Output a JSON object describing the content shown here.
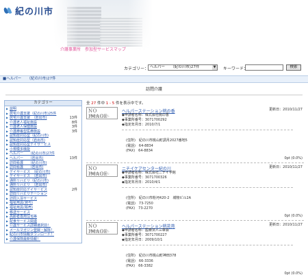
{
  "header": {
    "logo_text": "紀の川市",
    "subtitle": "介護事業所　参加型サービスマップ"
  },
  "search": {
    "category_label": "カテゴリー：",
    "category_value": "ヘルパー　　（紀の川市)27件",
    "keyword_label": "キーワード：",
    "keyword_value": "",
    "button_label": "検索"
  },
  "breadcrumb": "■ヘルパー　　（紀の川市)27件",
  "section_title": "訪問介護",
  "sidebar": {
    "title": "カテゴリー",
    "items": [
      {
        "label": "説明",
        "count": ""
      },
      {
        "label": "居宅介護支援（紀の川市)25件",
        "count": ""
      },
      {
        "label": "居宅介護支援　（岩出市)",
        "count": "13件"
      },
      {
        "label": "介護老人福祉施設",
        "count": "8件"
      },
      {
        "label": "介護老人保健施設",
        "count": "3件"
      },
      {
        "label": "介護療養型医療施設",
        "count": "3件"
      },
      {
        "label": "認知症対応型（紀の川市)",
        "count": ""
      },
      {
        "label": "認知症対応型（岩出市)",
        "count": ""
      },
      {
        "label": "認知症対応型デイサービス",
        "count": ""
      },
      {
        "label": "小規模多機能",
        "count": ""
      },
      {
        "label": "ヘルパー　　（紀の川市)27件",
        "count": ""
      },
      {
        "label": "ヘルパー　　（岩出市)",
        "count": "13件"
      },
      {
        "label": "訪問看護　　（紀の川市)",
        "count": ""
      },
      {
        "label": "訪問看護　　（岩出市)",
        "count": ""
      },
      {
        "label": "デイサービス　（紀の川市)",
        "count": ""
      },
      {
        "label": "デイサービス　（岩出市)",
        "count": ""
      },
      {
        "label": "通所リハビリ（紀の川市)",
        "count": ""
      },
      {
        "label": "通所リハビリ　（岩出市)",
        "count": ""
      },
      {
        "label": "認知症対応デイサービス",
        "count": "2件"
      },
      {
        "label": "訪問リハビリテーション",
        "count": ""
      },
      {
        "label": "訪問入浴サービス",
        "count": ""
      },
      {
        "label": "福祉用具(貸与)",
        "count": ""
      },
      {
        "label": "福祉用具(販売)",
        "count": ""
      },
      {
        "label": "移送サービス",
        "count": ""
      },
      {
        "label": "高齢者専用住宅等",
        "count": ""
      },
      {
        "label": "配食サービス関連",
        "count": ""
      },
      {
        "label": "介護サービス詳細選択前！",
        "count": ""
      },
      {
        "label": "メールマガジン登録・解除！",
        "count": ""
      },
      {
        "label": "紀の川市情報ダウンロード！",
        "count": ""
      },
      {
        "label": "介護保険最新情報！",
        "count": ""
      }
    ]
  },
  "results": {
    "summary_prefix": "全",
    "total": "27",
    "summary_mid": "件中",
    "range": "1 - 5",
    "summary_suffix": "件を表示中です。",
    "noimage_title": "NO IMAGE",
    "noimage_sub": "情報がありません",
    "rows": [
      {
        "name": "ヘルパーステーション桃の香",
        "date": "更新日：2010/11/27",
        "info": [
          "◆申請者名称：株式会社桃の香",
          "◆事業所番号：3071700292",
          "◆指定年月日：2010/7/1"
        ],
        "addr": "(住所)　紀の川市桃山町調月2027番地5",
        "tel": "(電話)　64-8834",
        "fax": "(FAX)　64-8834",
        "point": "0pt (0.0%)"
      },
      {
        "name": "ニチイケアセンター紀の川",
        "date": "更新日：2010/11/27",
        "info": [
          "◆申請者名称：株式会社ニチイ学館",
          "◆事業所番号：3071700326",
          "◆指定年月日：2010/4/1"
        ],
        "addr": "(住所)　紀の川市粉河420-2　城物ビル2A",
        "tel": "(電話)　73-7250",
        "fax": "(FAX)　73-2270",
        "point": "0pt (0.0%)"
      },
      {
        "name": "ヘルパーステーション桃花苑",
        "date": "更新日：2010/11/27",
        "info": [
          "◆申請者名称：医療法人三車会",
          "◆事業所番号：3071700227",
          "◆指定年月日：2009/10/1"
        ],
        "addr": "(住所)　紀の川市桃山町神田378",
        "tel": "(電話)　66-3336",
        "fax": "(FAX)　66-3382",
        "point": "0pt (0.0%)"
      }
    ]
  }
}
